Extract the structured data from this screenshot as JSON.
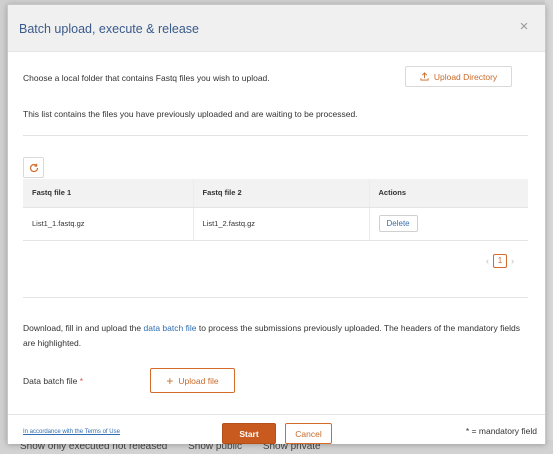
{
  "background": {
    "filters": [
      "Show only executed not released",
      "Show public",
      "Show private"
    ]
  },
  "modal": {
    "title": "Batch upload, execute & release",
    "close_icon": "×",
    "intro_text": "Choose a local folder that contains Fastq files you wish to upload.",
    "upload_directory_icon": "upload-icon",
    "upload_directory_label": "Upload Directory",
    "list_text": "This list contains the files you have previously uploaded and are waiting to be processed.",
    "refresh_icon": "refresh-icon",
    "table": {
      "headers": [
        "Fastq file 1",
        "Fastq file 2",
        "Actions"
      ],
      "rows": [
        {
          "file1": "List1_1.fastq.gz",
          "file2": "List1_2.fastq.gz",
          "action": "Delete"
        }
      ]
    },
    "pagination": {
      "prev": "‹",
      "current": "1",
      "next": "›"
    },
    "download_text_before": "Download, fill in and upload the",
    "download_link": "data batch file",
    "download_text_after": "to process the submissions previously uploaded. The headers of the mandatory fields are highlighted.",
    "batch_label": "Data batch file",
    "required_marker": "*",
    "upload_file_label": "Upload file",
    "footer": {
      "terms": "In accordance with the Terms of Use",
      "start": "Start",
      "cancel": "Cancel",
      "mandatory_note": "* = mandatory field"
    }
  },
  "colors": {
    "accent": "#c85a20",
    "title": "#3a5a8a",
    "link": "#2f6db0"
  }
}
